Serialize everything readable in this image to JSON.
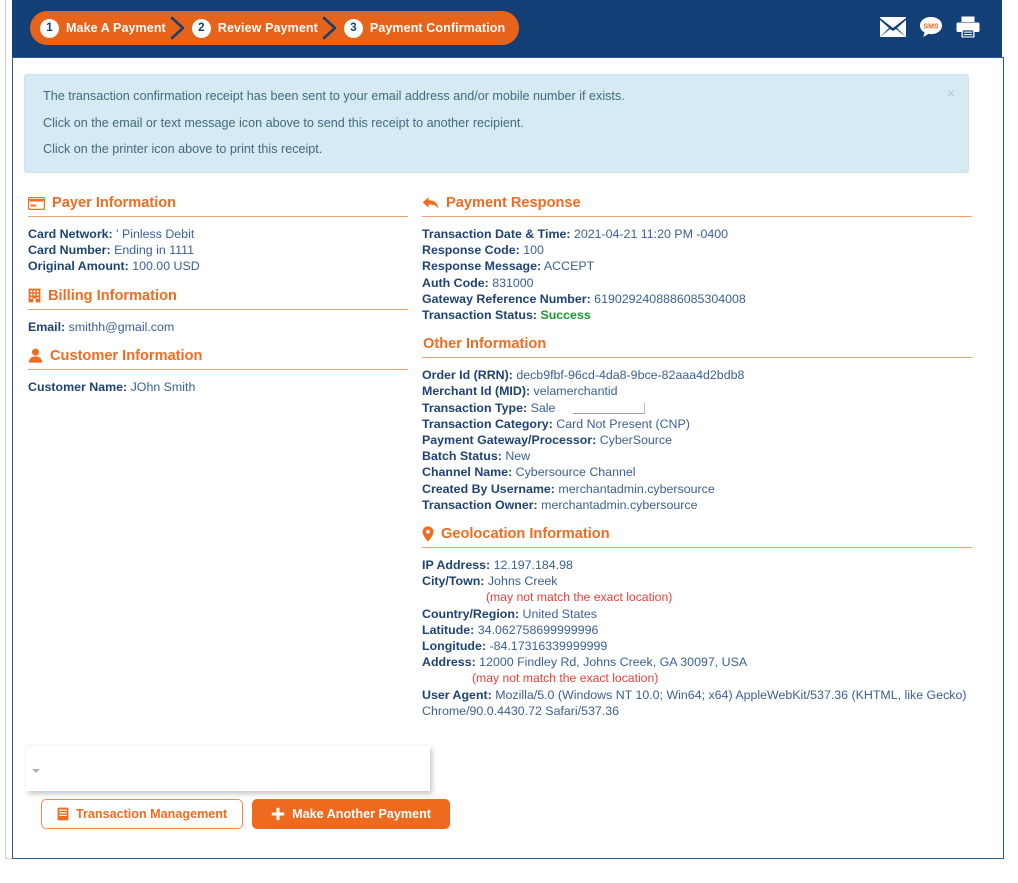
{
  "header": {
    "steps": [
      {
        "num": "1",
        "label": "Make A Payment"
      },
      {
        "num": "2",
        "label": "Review Payment"
      },
      {
        "num": "3",
        "label": "Payment Confirmation"
      }
    ],
    "icons": [
      {
        "name": "email-icon",
        "title": "Email receipt"
      },
      {
        "name": "sms-icon",
        "title": "Text message receipt",
        "glyph": "SMS"
      },
      {
        "name": "printer-icon",
        "title": "Print receipt"
      }
    ]
  },
  "alert": {
    "line1": "The transaction confirmation receipt has been sent to your email address and/or mobile number if exists.",
    "line2": "Click on the email or text message icon above to send this receipt to another recipient.",
    "line3": "Click on the printer icon above to print this receipt.",
    "close": "×"
  },
  "payer_information": {
    "title": "Payer Information",
    "icon": "credit-card-icon",
    "rows": [
      {
        "label": "Card Network:",
        "value": "' Pinless Debit"
      },
      {
        "label": "Card Number:",
        "value": "Ending in 1111"
      },
      {
        "label": "Original Amount:",
        "value": "100.00 USD"
      }
    ]
  },
  "billing_information": {
    "title": "Billing Information",
    "icon": "building-icon",
    "rows": [
      {
        "label": "Email:",
        "value": "smithh@gmail.com"
      }
    ]
  },
  "customer_information": {
    "title": "Customer Information",
    "icon": "person-icon",
    "rows": [
      {
        "label": "Customer Name:",
        "value": "JOhn Smith"
      }
    ]
  },
  "payment_response": {
    "title": "Payment Response",
    "icon": "reply-arrow-icon",
    "rows": [
      {
        "label": "Transaction Date & Time:",
        "value": "2021-04-21 11:20 PM -0400"
      },
      {
        "label": "Response Code:",
        "value": "100"
      },
      {
        "label": "Response Message:",
        "value": "ACCEPT"
      },
      {
        "label": "Auth Code:",
        "value": "831000"
      },
      {
        "label": "Gateway Reference Number:",
        "value": "6190292408886085304008"
      },
      {
        "label": "Transaction Status:",
        "value": "Success",
        "status": "success"
      }
    ]
  },
  "other_information": {
    "title": "Other Information",
    "rows": [
      {
        "label": "Order Id (RRN):",
        "value": "decb9fbf-96cd-4da8-9bce-82aaa4d2bdb8"
      },
      {
        "label": "Merchant Id (MID):",
        "value": "velamerchantid"
      },
      {
        "label": "Transaction Type:",
        "value": "Sale"
      },
      {
        "label": "Transaction Category:",
        "value": "Card Not Present (CNP)"
      },
      {
        "label": "Payment Gateway/Processor:",
        "value": "CyberSource"
      },
      {
        "label": "Batch Status:",
        "value": "New"
      },
      {
        "label": "Channel Name:",
        "value": "Cybersource Channel"
      },
      {
        "label": "Created By Username:",
        "value": "merchantadmin.cybersource"
      },
      {
        "label": "Transaction Owner:",
        "value": "merchantadmin.cybersource"
      }
    ]
  },
  "geolocation_information": {
    "title": "Geolocation Information",
    "icon": "map-pin-icon",
    "ip_label": "IP Address:",
    "ip_value": "12.197.184.98",
    "city_label": "City/Town:",
    "city_value": "Johns Creek",
    "city_note": "(may not match the exact location)",
    "country_label": "Country/Region:",
    "country_value": "United States",
    "latitude_label": "Latitude:",
    "latitude_value": "34.062758699999996",
    "longitude_label": "Longitude:",
    "longitude_value": "-84.17316339999999",
    "address_label": "Address:",
    "address_value": "12000 Findley Rd, Johns Creek, GA 30097, USA",
    "address_note": "(may not match the exact location)",
    "user_agent_label": "User Agent:",
    "user_agent_value": "Mozilla/5.0 (Windows NT 10.0; Win64; x64) AppleWebKit/537.36 (KHTML, like Gecko) Chrome/90.0.4430.72 Safari/537.36"
  },
  "footer": {
    "transaction_management_label": "Transaction Management",
    "transaction_management_icon": "list-document-icon",
    "make_another_payment_label": "Make Another Payment",
    "make_another_payment_icon": "plus-icon"
  },
  "colors": {
    "header_navy": "#113f76",
    "accent_orange": "#ef6c22",
    "breadcrumb_orange": "#e8631a",
    "alert_bg": "#d6eaf3",
    "label_blue": "#1e4272",
    "value_blue": "#3a6094",
    "success_green": "#179c2b",
    "note_red": "#e8403a"
  }
}
